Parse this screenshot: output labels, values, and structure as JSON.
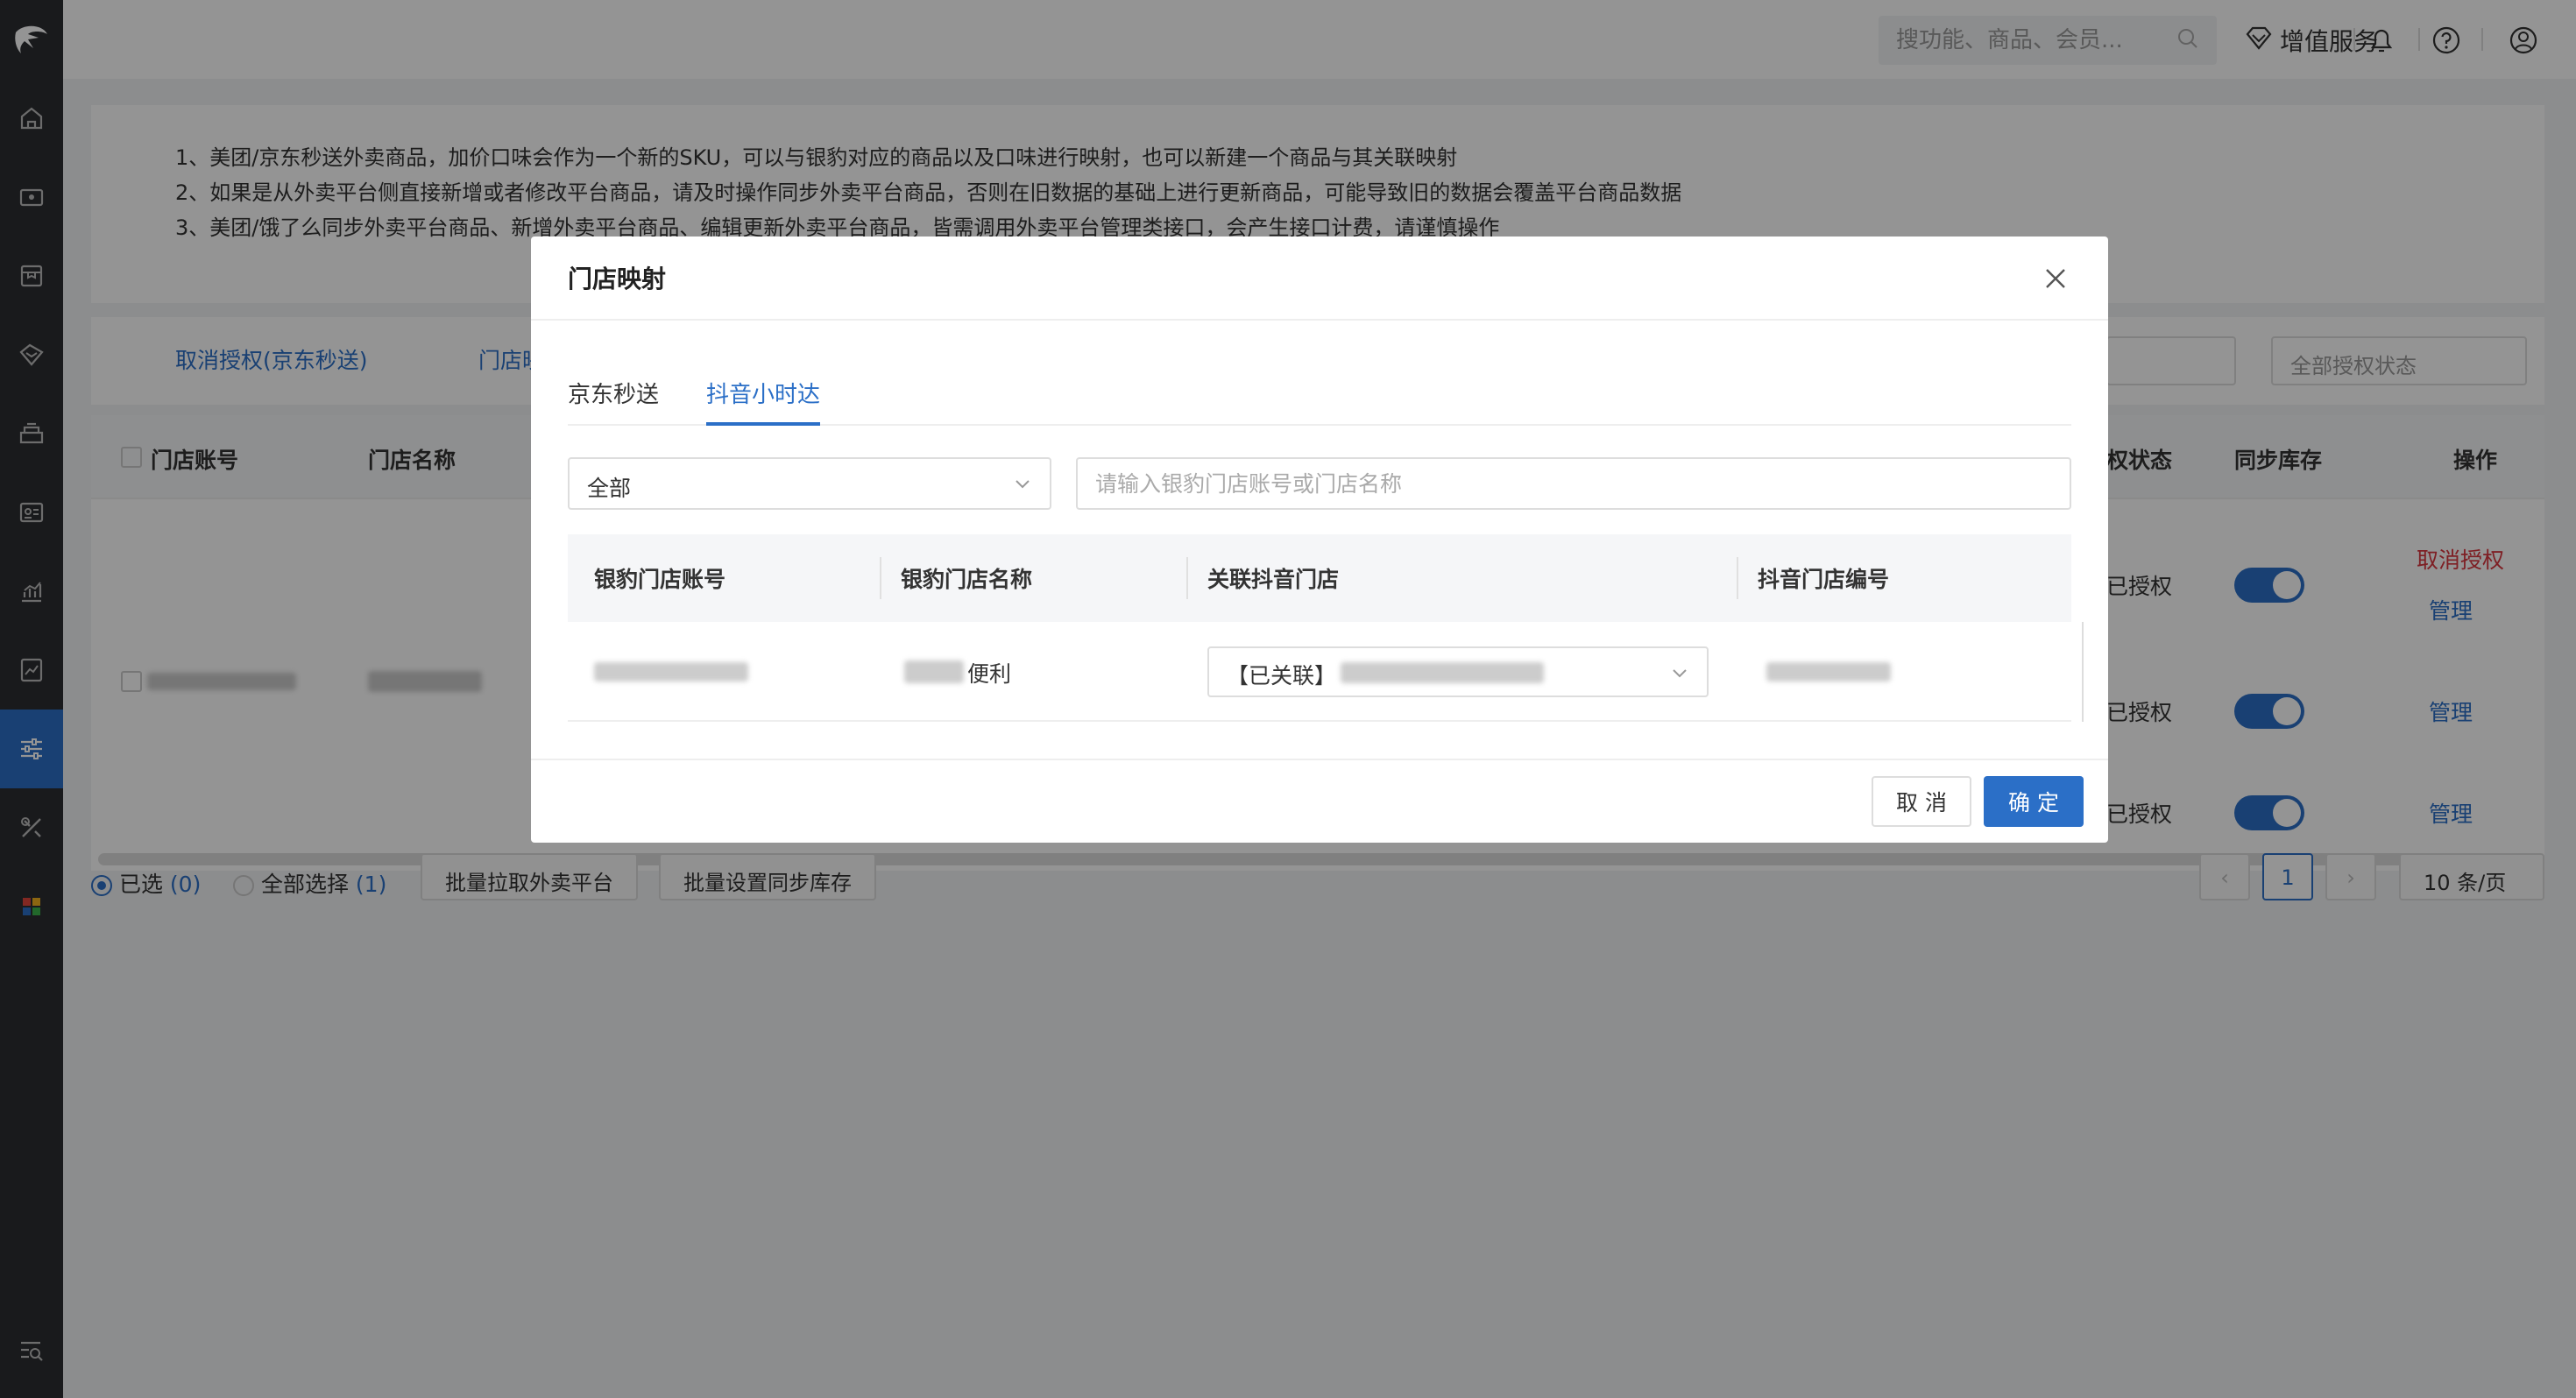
{
  "topbar": {
    "search_placeholder": "搜功能、商品、会员...",
    "vip_label": "增值服务",
    "icons": [
      "search-icon",
      "diamond-icon",
      "bell-icon",
      "help-icon",
      "user-icon"
    ]
  },
  "sidebar": {
    "icons": [
      "logo-icon",
      "home-icon",
      "wallet-icon",
      "box-icon",
      "tag-icon",
      "cashier-icon",
      "member-card-icon",
      "chart-icon",
      "report-icon",
      "settings-sliders-icon",
      "tools-icon",
      "apps-icon",
      "search-list-icon"
    ],
    "active_index": 8
  },
  "notice": {
    "lines": [
      "1、美团/京东秒送外卖商品，加价口味会作为一个新的SKU，可以与银豹对应的商品以及口味进行映射，也可以新建一个商品与其关联映射",
      "2、如果是从外卖平台侧直接新增或者修改平台商品，请及时操作同步外卖平台商品，否则在旧数据的基础上进行更新商品，可能导致旧的数据会覆盖平台商品数据",
      "3、美团/饿了么同步外卖平台商品、新增外卖平台商品、编辑更新外卖平台商品，皆需调用外卖平台管理类接口，会产生接口计费，请谨慎操作"
    ]
  },
  "filterbar": {
    "link_cancel_auth": "取消授权(京东秒送)",
    "link_store_map": "门店映射",
    "auth_status_placeholder": "全部授权状态"
  },
  "table": {
    "headers": {
      "account": "门店账号",
      "name": "门店名称",
      "auth_status": "权状态",
      "sync_stock": "同步库存",
      "actions": "操作"
    },
    "rows": [
      {
        "auth": "已授权",
        "action1": "取消授权",
        "action2": "管理"
      },
      {
        "auth": "已授权",
        "action1": "",
        "action2": "管理"
      },
      {
        "auth": "已授权",
        "action1": "",
        "action2": "管理"
      }
    ]
  },
  "footer_bar": {
    "selected_label": "已选",
    "selected_count": "(0)",
    "select_all_label": "全部选择",
    "select_all_count": "(1)",
    "batch_pull": "批量拉取外卖平台",
    "batch_stock": "批量设置同步库存",
    "current_page": "1",
    "page_size": "10 条/页"
  },
  "modal": {
    "title": "门店映射",
    "tabs": [
      {
        "label": "京东秒送",
        "active": false
      },
      {
        "label": "抖音小时达",
        "active": true
      }
    ],
    "filter_select": "全部",
    "search_placeholder": "请输入银豹门店账号或门店名称",
    "columns": [
      "银豹门店账号",
      "银豹门店名称",
      "关联抖音门店",
      "抖音门店编号"
    ],
    "row": {
      "store_name_suffix": "便利",
      "link_prefix": "【已关联】"
    },
    "cancel_label": "取 消",
    "ok_label": "确 定"
  },
  "colors": {
    "accent": "#2b6fc7",
    "danger": "#d9363e",
    "sidebar_bg": "#2b2d31"
  }
}
